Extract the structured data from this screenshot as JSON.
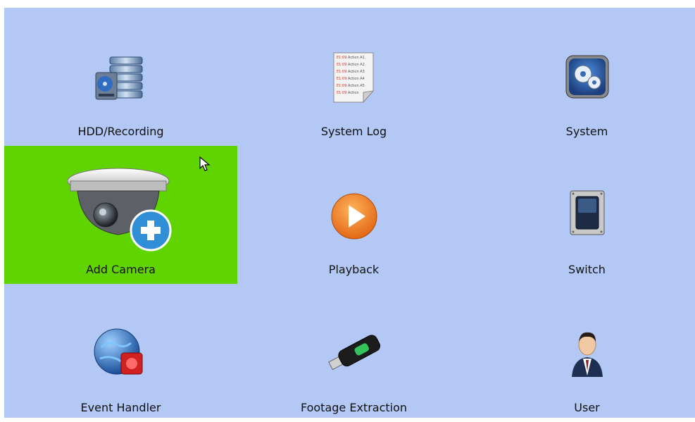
{
  "menu": {
    "items": [
      {
        "label": "HDD/Recording",
        "icon": "hdd-recording-icon"
      },
      {
        "label": "System Log",
        "icon": "system-log-icon"
      },
      {
        "label": "System",
        "icon": "system-gear-icon"
      },
      {
        "label": "Add Camera",
        "icon": "add-camera-icon",
        "selected": true
      },
      {
        "label": "Playback",
        "icon": "playback-icon"
      },
      {
        "label": "Switch",
        "icon": "switch-icon"
      },
      {
        "label": "Event Handler",
        "icon": "event-handler-icon"
      },
      {
        "label": "Footage Extraction",
        "icon": "usb-drive-icon"
      },
      {
        "label": "User",
        "icon": "user-icon"
      }
    ]
  },
  "log_preview": {
    "lines": [
      {
        "time": "E1:09",
        "text": "Action A1"
      },
      {
        "time": "E1:09",
        "text": "Action A2"
      },
      {
        "time": "E1:09",
        "text": "Action A3"
      },
      {
        "time": "E1:09",
        "text": "Action A4"
      },
      {
        "time": "E1:09",
        "text": "Action A5"
      },
      {
        "time": "E1:09",
        "text": "Action"
      }
    ]
  },
  "colors": {
    "background": "#b3c8f5",
    "selected": "#5fd400",
    "playback": "#f07a1a"
  }
}
